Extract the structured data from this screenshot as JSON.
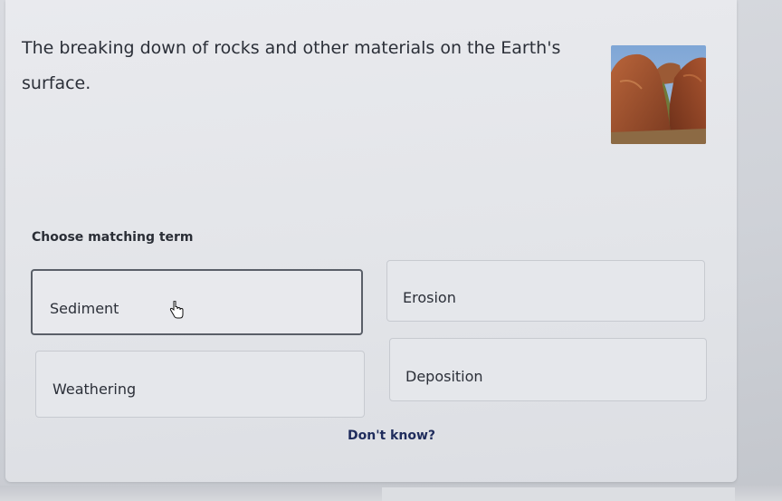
{
  "question": {
    "prompt": "The breaking down of rocks and other materials on the Earth's surface."
  },
  "instruction": "Choose matching term",
  "options": [
    {
      "label": "Sediment"
    },
    {
      "label": "Erosion"
    },
    {
      "label": "Weathering"
    },
    {
      "label": "Deposition"
    }
  ],
  "dont_know": "Don't know?",
  "colors": {
    "card_bg": "#e6e8ec",
    "text": "#2b2f38",
    "link": "#1f2c5c",
    "selected_border": "#5a5f68"
  },
  "icons": {
    "cursor": "hand-pointer-icon",
    "photo": "red-rocks-photo"
  }
}
